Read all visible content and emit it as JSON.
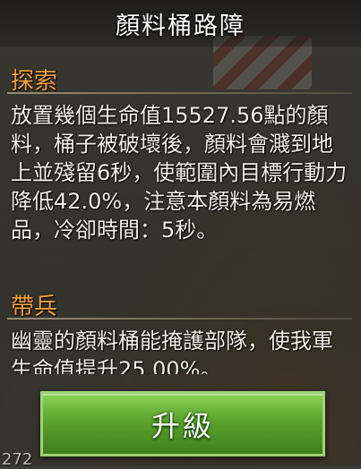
{
  "header": {
    "title": "顏料桶路障"
  },
  "explore": {
    "heading": "探索",
    "text": "放置幾個生命值15527.56點的顏料，桶子被破壞後，顏料會濺到地上並殘留6秒，使範圍內目標行動力降低42.0%，注意本顏料為易燃品，冷卻時間：5秒。"
  },
  "troops": {
    "heading": "帶兵",
    "text": "幽靈的顏料桶能掩護部隊，使我軍生命值提升25.00%。"
  },
  "actions": {
    "upgrade_label": "升級"
  },
  "footer": {
    "corner_number": "272"
  },
  "colors": {
    "section_heading": "#f2a23a",
    "button_green": "#5aa32c",
    "text": "#f3efe6"
  }
}
